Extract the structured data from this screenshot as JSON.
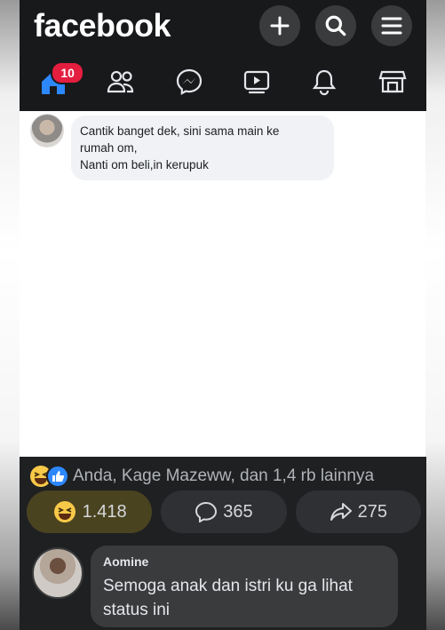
{
  "app": {
    "brand": "facebook"
  },
  "topbar": {
    "buttons": [
      {
        "name": "create",
        "icon": "plus-icon"
      },
      {
        "name": "search",
        "icon": "search-icon"
      },
      {
        "name": "menu",
        "icon": "hamburger-icon"
      }
    ]
  },
  "nav": {
    "items": [
      {
        "name": "home",
        "icon": "home-icon",
        "active": true
      },
      {
        "name": "friends",
        "icon": "friends-icon"
      },
      {
        "name": "messenger",
        "icon": "messenger-icon"
      },
      {
        "name": "watch",
        "icon": "video-icon"
      },
      {
        "name": "notifications",
        "icon": "bell-icon"
      },
      {
        "name": "marketplace",
        "icon": "shop-icon"
      }
    ],
    "home_badge": "10"
  },
  "comment_top": {
    "text_line1": "Cantik banget dek, sini sama main ke",
    "text_line2": "rumah om,",
    "text_line3": "Nanti om beli,in kerupuk"
  },
  "post": {
    "reactions_summary": "Anda, Kage Mazeww, dan 1,4 rb lainnya",
    "reaction_count": "1.418",
    "comment_count": "365",
    "share_count": "275"
  },
  "comment2": {
    "author": "Aomine",
    "text_line1": "Semoga anak dan istri ku ga lihat",
    "text_line2": "status ini"
  },
  "colors": {
    "topbar_bg": "#18191b",
    "panel_bg": "#1f2022",
    "badge": "#e41e3f",
    "like_blue": "#2d88ff",
    "haha_yellow": "#f7c948"
  }
}
